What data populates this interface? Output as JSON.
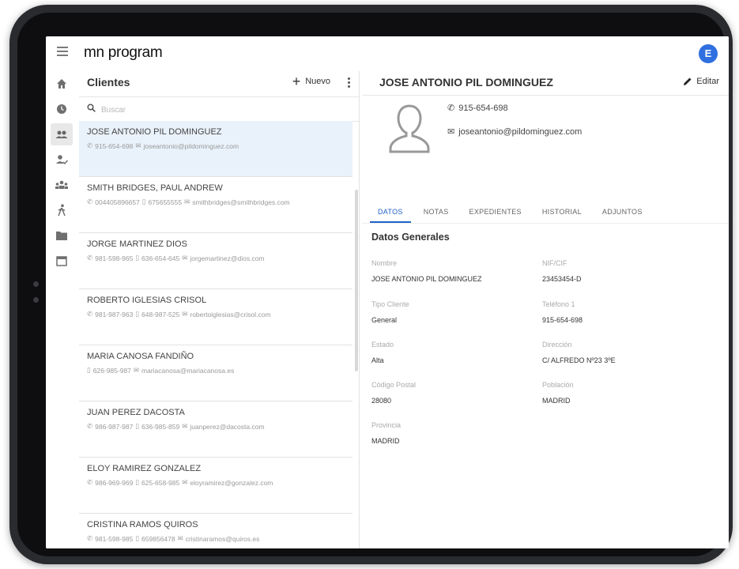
{
  "app": {
    "logo": "mn program",
    "user_initial": "E"
  },
  "list": {
    "title": "Clientes",
    "new_label": "Nuevo",
    "search_placeholder": "Buscar",
    "items": [
      {
        "name": "JOSE ANTONIO PIL DOMINGUEZ",
        "phone": "915-654-698",
        "mobile": "",
        "email": "joseantonio@pildominguez.com"
      },
      {
        "name": "SMITH BRIDGES, PAUL ANDREW",
        "phone": "004405896657",
        "mobile": "675655555",
        "email": "smithbridges@smithbridges.com"
      },
      {
        "name": "JORGE MARTINEZ DIOS",
        "phone": "981-598-965",
        "mobile": "636-654-645",
        "email": "jorgemartinez@dios.com"
      },
      {
        "name": "ROBERTO IGLESIAS CRISOL",
        "phone": "981-987-963",
        "mobile": "648-987-525",
        "email": "robertoiglesias@crisol.com"
      },
      {
        "name": "MARIA CANOSA FANDIÑO",
        "phone": "",
        "mobile": "626-985-987",
        "email": "mariacanosa@mariacanosa.es"
      },
      {
        "name": "JUAN PEREZ DACOSTA",
        "phone": "986-987-987",
        "mobile": "636-985-859",
        "email": "juanperez@dacosta.com"
      },
      {
        "name": "ELOY RAMIREZ GONZALEZ",
        "phone": "986-969-969",
        "mobile": "625-658-985",
        "email": "eloyramirez@gonzalez.com"
      },
      {
        "name": "CRISTINA RAMOS QUIROS",
        "phone": "981-598-985",
        "mobile": "659856478",
        "email": "cristinaramos@quiros.es"
      }
    ]
  },
  "detail": {
    "title": "JOSE ANTONIO PIL DOMINGUEZ",
    "edit_label": "Editar",
    "phone": "915-654-698",
    "email": "joseantonio@pildominguez.com",
    "tabs": [
      "DATOS",
      "NOTAS",
      "EXPEDIENTES",
      "HISTORIAL",
      "ADJUNTOS"
    ],
    "active_tab": "DATOS",
    "section_title": "Datos Generales",
    "fields": {
      "nombre": {
        "label": "Nombre",
        "value": "JOSE ANTONIO PIL DOMINGUEZ"
      },
      "nif": {
        "label": "NIF/CIF",
        "value": "23453454-D"
      },
      "tipo": {
        "label": "Tipo Cliente",
        "value": "General"
      },
      "telefono": {
        "label": "Teléfono 1",
        "value": "915-654-698"
      },
      "estado": {
        "label": "Estado",
        "value": "Alta"
      },
      "direccion": {
        "label": "Dirección",
        "value": "C/ ALFREDO Nº23 3ºE"
      },
      "cp": {
        "label": "Código Postal",
        "value": "28080"
      },
      "poblacion": {
        "label": "Población",
        "value": "MADRID"
      },
      "provincia": {
        "label": "Provincia",
        "value": "MADRID"
      }
    }
  },
  "colors": {
    "accent": "#1f62c9",
    "avatar": "#2f6fe0",
    "selected_row": "#e9f2fb"
  }
}
